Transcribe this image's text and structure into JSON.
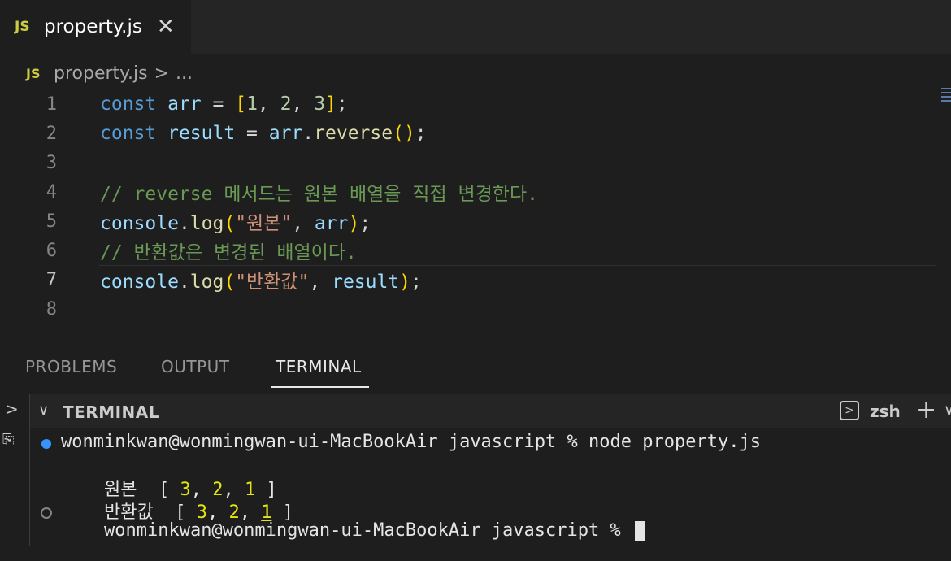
{
  "tab": {
    "badge": "JS",
    "label": "property.js",
    "close": "✕"
  },
  "breadcrumb": {
    "badge": "JS",
    "file": "property.js",
    "sep": ">",
    "more": "..."
  },
  "editor": {
    "line_numbers": [
      "1",
      "2",
      "3",
      "4",
      "5",
      "6",
      "7",
      "8"
    ],
    "active_line": "7",
    "lines": [
      [
        {
          "t": "const",
          "c": "kw"
        },
        {
          "t": " ",
          "c": ""
        },
        {
          "t": "arr",
          "c": "var"
        },
        {
          "t": " = ",
          "c": ""
        },
        {
          "t": "[",
          "c": "br1"
        },
        {
          "t": "1",
          "c": "num"
        },
        {
          "t": ", ",
          "c": ""
        },
        {
          "t": "2",
          "c": "num"
        },
        {
          "t": ", ",
          "c": ""
        },
        {
          "t": "3",
          "c": "num"
        },
        {
          "t": "]",
          "c": "br1"
        },
        {
          "t": ";",
          "c": ""
        }
      ],
      [
        {
          "t": "const",
          "c": "kw"
        },
        {
          "t": " ",
          "c": ""
        },
        {
          "t": "result",
          "c": "var"
        },
        {
          "t": " = ",
          "c": ""
        },
        {
          "t": "arr",
          "c": "var"
        },
        {
          "t": ".",
          "c": ""
        },
        {
          "t": "reverse",
          "c": "fn"
        },
        {
          "t": "()",
          "c": "br1"
        },
        {
          "t": ";",
          "c": ""
        }
      ],
      [],
      [
        {
          "t": "// reverse 메서드는 원본 배열을 직접 변경한다.",
          "c": "cmt"
        }
      ],
      [
        {
          "t": "console",
          "c": "var"
        },
        {
          "t": ".",
          "c": ""
        },
        {
          "t": "log",
          "c": "fn"
        },
        {
          "t": "(",
          "c": "br1"
        },
        {
          "t": "\"원본\"",
          "c": "str"
        },
        {
          "t": ", ",
          "c": ""
        },
        {
          "t": "arr",
          "c": "var"
        },
        {
          "t": ")",
          "c": "br1"
        },
        {
          "t": ";",
          "c": ""
        }
      ],
      [
        {
          "t": "// 반환값은 변경된 배열이다.",
          "c": "cmt"
        }
      ],
      [
        {
          "t": "console",
          "c": "var"
        },
        {
          "t": ".",
          "c": ""
        },
        {
          "t": "log",
          "c": "fn"
        },
        {
          "t": "(",
          "c": "br1"
        },
        {
          "t": "\"반환값\"",
          "c": "str"
        },
        {
          "t": ", ",
          "c": ""
        },
        {
          "t": "result",
          "c": "var"
        },
        {
          "t": ")",
          "c": "br1"
        },
        {
          "t": ";",
          "c": ""
        }
      ],
      []
    ]
  },
  "panel": {
    "tabs": [
      "PROBLEMS",
      "OUTPUT",
      "TERMINAL"
    ],
    "active_tab": "TERMINAL",
    "header_title": "TERMINAL",
    "shell": "zsh"
  },
  "terminal": {
    "line1": "wonminkwan@wonmingwan-ui-MacBookAir javascript % node property.js",
    "line2_label": "원본 ",
    "line2_open": " [ ",
    "line2_nums": [
      "3",
      "2",
      "1"
    ],
    "line2_close": " ]",
    "line3_label": "반환값 ",
    "line3_open": " [ ",
    "line3_nums": [
      "3",
      "2",
      "1"
    ],
    "line3_close": " ]",
    "line4": "wonminkwan@wonmingwan-ui-MacBookAir javascript % "
  },
  "colors": {
    "accent": "#3794ff",
    "editor_bg": "#1e1e1e",
    "tabbar_bg": "#252526"
  }
}
